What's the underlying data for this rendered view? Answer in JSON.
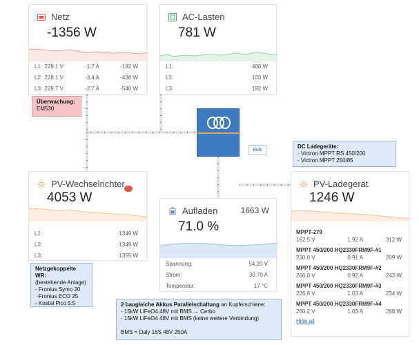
{
  "netz": {
    "title": "Netz",
    "power": "-1356 W",
    "rows": [
      {
        "label": "L1:",
        "voltage": "229.1 V",
        "current": "-1.7 A",
        "power": "-192 W"
      },
      {
        "label": "L2:",
        "voltage": "228.1 V",
        "current": "-3.4 A",
        "power": "-438 W"
      },
      {
        "label": "L3:",
        "voltage": "229.7 V",
        "current": "-2.7 A",
        "power": "-540 W"
      }
    ]
  },
  "ac_lasten": {
    "title": "AC-Lasten",
    "power": "781 W",
    "rows": [
      {
        "label": "L1:",
        "power": "486 W"
      },
      {
        "label": "L2:",
        "power": "103 W"
      },
      {
        "label": "L3:",
        "power": "192 W"
      }
    ]
  },
  "pv_inverter": {
    "title": "PV-Wechselrichter",
    "power": "4053 W",
    "rows": [
      {
        "label": "L1:",
        "power": "1349 W"
      },
      {
        "label": "L2:",
        "power": "1349 W"
      },
      {
        "label": "L3:",
        "power": "1355 W"
      }
    ]
  },
  "battery": {
    "title": "Aufladen",
    "power": "1663 W",
    "soc": "71.0 %",
    "soc_fraction": 0.71,
    "rows": [
      {
        "label": "Spannung:",
        "value": "54.20 V"
      },
      {
        "label": "Strom:",
        "value": "30.70 A"
      },
      {
        "label": "Temperatur:",
        "value": "17 °C"
      }
    ],
    "state_badge": "Bulk"
  },
  "pv_charger": {
    "title": "PV-Ladegerät",
    "power": "1246 W",
    "chargers": [
      {
        "name": "MPPT-279",
        "voltage": "162.5 V",
        "current": "1.92 A",
        "power": "312 W"
      },
      {
        "name": "MPPT 450/200 HQ2330FRM9F-#1",
        "voltage": "230.0 V",
        "current": "0.91 A",
        "power": "209 W"
      },
      {
        "name": "MPPT 450/200 HQ2330FRM9F-#2",
        "voltage": "266.0 V",
        "current": "0.92 A",
        "power": "243 W"
      },
      {
        "name": "MPPT 450/200 HQ2330FRM9F-#3",
        "voltage": "226.8 V",
        "current": "1.03 A",
        "power": "234 W"
      },
      {
        "name": "MPPT 450/200 HQ2330FRM9F-#4",
        "voltage": "260.2 V",
        "current": "1.03 A",
        "power": "268 W"
      }
    ],
    "hide_all": "Hide all"
  },
  "notes": {
    "ueberwachung": {
      "title": "Überwachung:",
      "lines": [
        "EM530"
      ]
    },
    "dc_ladegeraete": {
      "title": "DC Ladegeräte:",
      "lines": [
        "- Victron MPPT RS 450/200",
        "- Victron MPPT 250/85"
      ]
    },
    "netzgekoppelte": {
      "title": "Netzgekoppelte WR:",
      "lines": [
        "(bestehende Anlage)",
        "- Fronius Symo 20",
        " -Fronius ECO 25",
        "- Kostal Pico 5.5"
      ]
    },
    "akkus": {
      "title_bold": "2 baugleiche Akkus Parallelschaltung",
      "title_rest": " an Kupferschiene:",
      "lines": [
        "- 15kW LiFeO4 48V mit BMS → Cerbo",
        "- 15kW LiFeO4 48V mit BMS (keine weitere Verbindung)",
        "",
        "BMS = Daly 16S 48V 250A"
      ]
    }
  },
  "icons": {
    "netz": "grid-icon",
    "ac_lasten": "ac-load-icon",
    "pv_inverter": "sun-icon",
    "battery": "battery-icon",
    "pv_charger": "sun-icon",
    "fronius": "fronius-logo",
    "victron": "victron-logo"
  },
  "colors": {
    "netz_accent": "#e05a4a",
    "ac_accent": "#46b06c",
    "pv_accent": "#f2a55a",
    "battery_accent": "#4a90d9",
    "victron_blue": "#3c7bc2",
    "flow_line": "#e4e4e4",
    "flow_dot": "#4a90d9",
    "note_red_bg": "#f7c5c5",
    "note_blue_bg": "#dfe9f7"
  }
}
